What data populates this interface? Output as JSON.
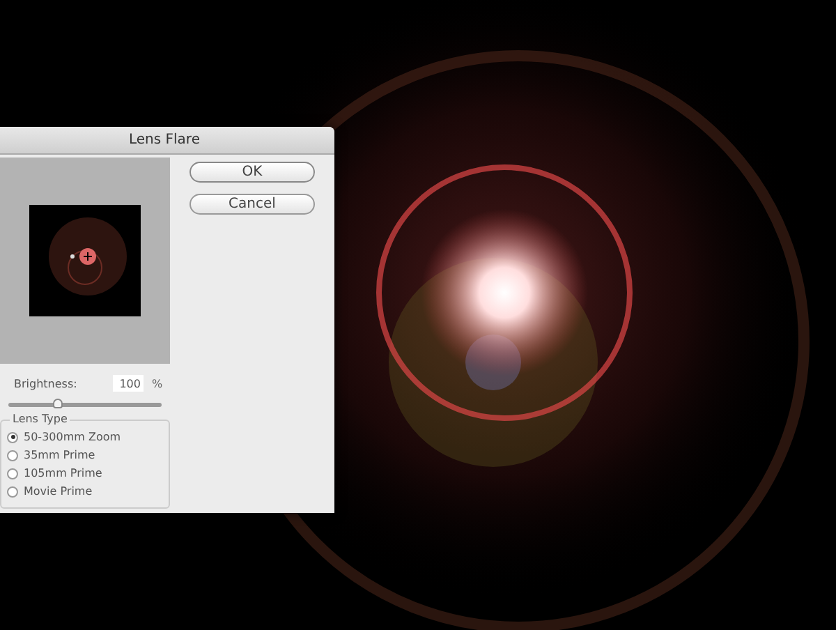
{
  "dialog": {
    "title": "Lens Flare",
    "buttons": [
      {
        "label": "OK",
        "kind": "default"
      },
      {
        "label": "Cancel",
        "kind": "normal"
      }
    ],
    "brightness": {
      "label": "Brightness:",
      "value": "100",
      "unit": "%",
      "level": 0.32
    },
    "lens_type": {
      "title": "Lens Type",
      "options": [
        {
          "label": "50-300mm Zoom",
          "selected": true
        },
        {
          "label": "35mm Prime",
          "selected": false
        },
        {
          "label": "105mm Prime",
          "selected": false
        },
        {
          "label": "Movie Prime",
          "selected": false
        }
      ]
    }
  }
}
